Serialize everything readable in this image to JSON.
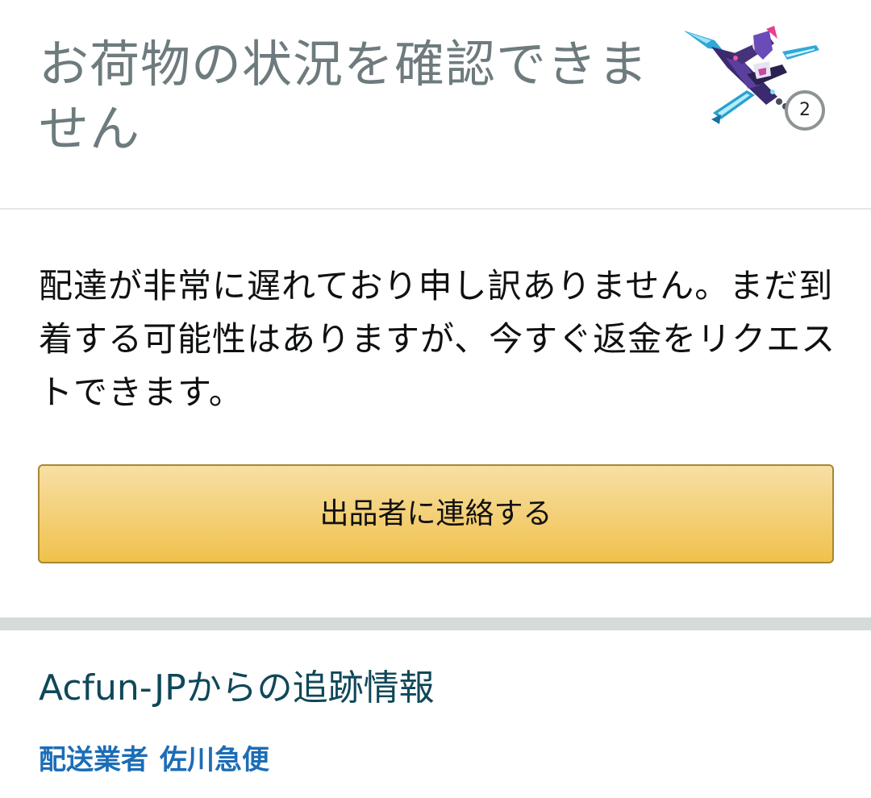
{
  "header": {
    "title": "お荷物の状況を確認できません",
    "product": {
      "image": "robot-figure-thumbnail",
      "quantity": "2"
    }
  },
  "message": {
    "text": "配達が非常に遅れており申し訳ありません。まだ到着する可能性はありますが、今すぐ返金をリクエストできます。"
  },
  "actions": {
    "contact_seller_label": "出品者に連絡する"
  },
  "tracking": {
    "heading": "Acfun-JPからの追跡情報",
    "carrier_label": "配送業者",
    "carrier_name": "佐川急便"
  },
  "colors": {
    "title": "#6e7b7e",
    "body_text": "#0f1111",
    "button_top": "#f7dfa5",
    "button_bottom": "#f0c14b",
    "button_border": "#a88734",
    "heading": "#0f4858",
    "link": "#1c6db6",
    "divider": "#d5dbdb"
  }
}
